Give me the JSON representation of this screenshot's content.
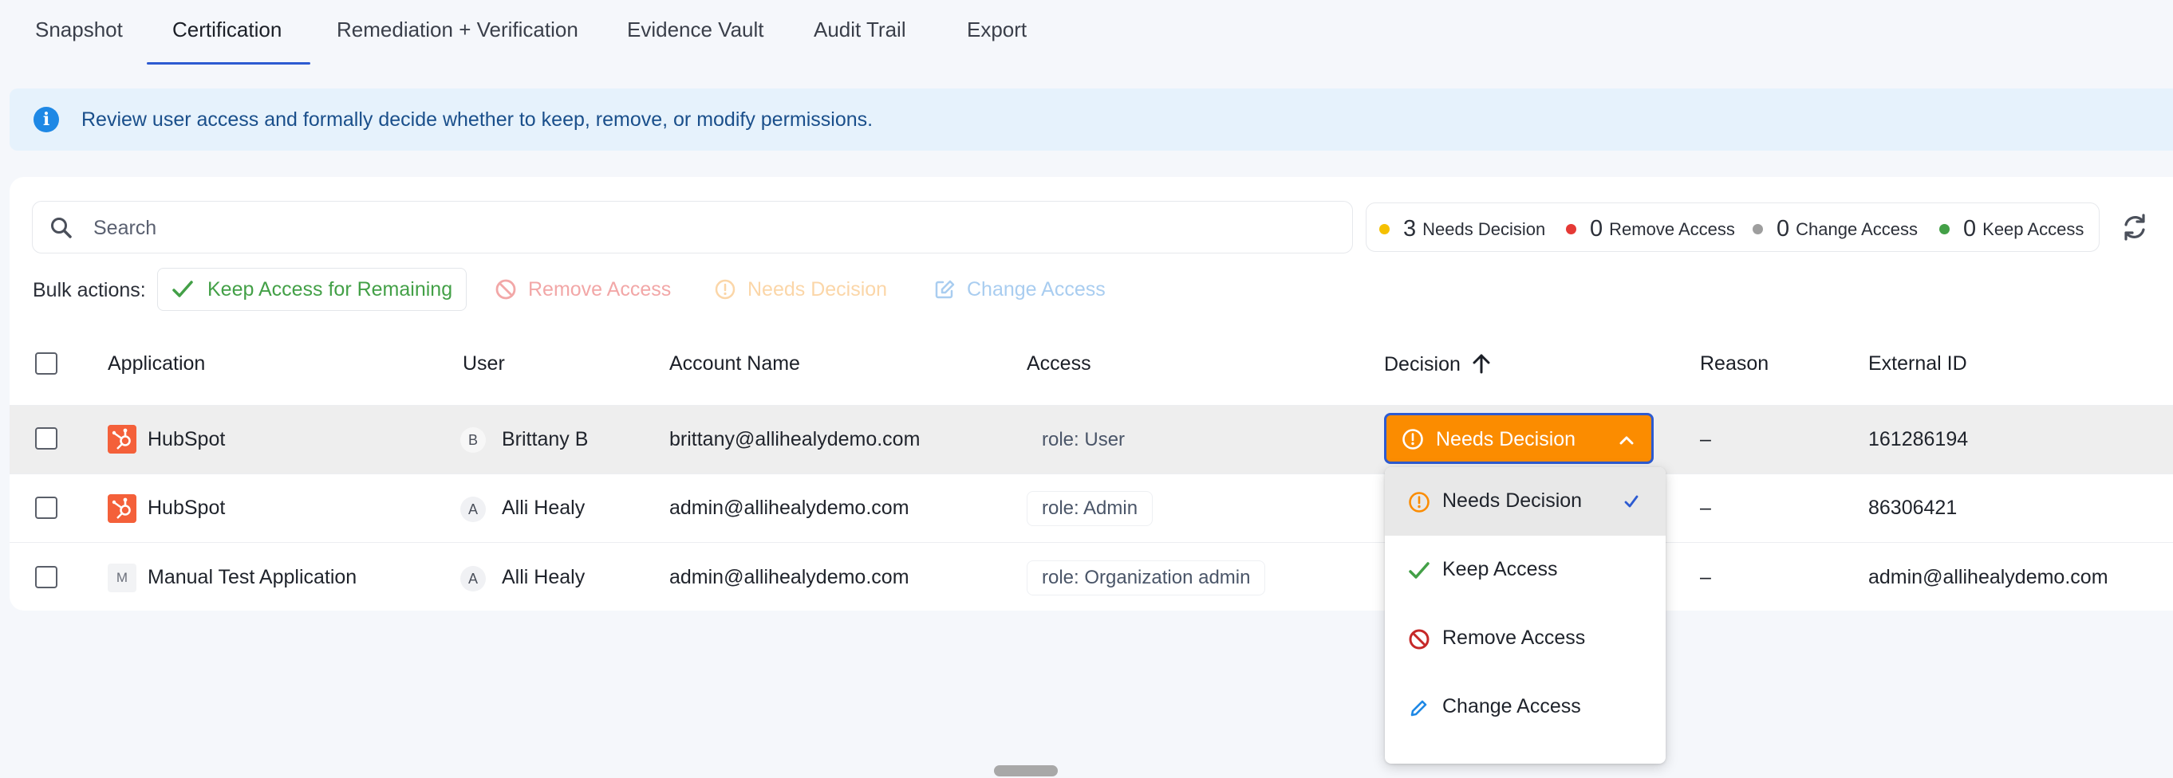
{
  "tabs": [
    {
      "label": "Snapshot"
    },
    {
      "label": "Certification"
    },
    {
      "label": "Remediation + Verification"
    },
    {
      "label": "Evidence Vault"
    },
    {
      "label": "Audit Trail"
    },
    {
      "label": "Export"
    }
  ],
  "active_tab": "Certification",
  "banner": {
    "text": "Review user access and formally decide whether to keep, remove, or modify permissions."
  },
  "search": {
    "placeholder": "Search",
    "value": ""
  },
  "counts": [
    {
      "num": "3",
      "label": "Needs Decision",
      "color": "#f5c000"
    },
    {
      "num": "0",
      "label": "Remove Access",
      "color": "#e53935"
    },
    {
      "num": "0",
      "label": "Change Access",
      "color": "#9e9e9e"
    },
    {
      "num": "0",
      "label": "Keep Access",
      "color": "#43a047"
    }
  ],
  "bulk": {
    "label": "Bulk actions:",
    "keep": "Keep Access for Remaining",
    "remove": "Remove Access",
    "needs": "Needs Decision",
    "change": "Change Access"
  },
  "table": {
    "headers": {
      "application": "Application",
      "user": "User",
      "account": "Account Name",
      "access": "Access",
      "decision": "Decision",
      "reason": "Reason",
      "external_id": "External ID"
    },
    "rows": [
      {
        "app": "HubSpot",
        "avatar": "B",
        "user": "Brittany B",
        "account": "brittany@allihealydemo.com",
        "access": "role: User",
        "reason": "–",
        "external_id": "161286194"
      },
      {
        "app": "HubSpot",
        "avatar": "A",
        "user": "Alli Healy",
        "account": "admin@allihealydemo.com",
        "access": "role: Admin",
        "reason": "–",
        "external_id": "86306421"
      },
      {
        "app": "Manual Test Application",
        "app_initial": "M",
        "avatar": "A",
        "user": "Alli Healy",
        "account": "admin@allihealydemo.com",
        "access": "role: Organization admin",
        "reason": "–",
        "external_id": "admin@allihealydemo.com"
      }
    ]
  },
  "decision_select": {
    "value": "Needs Decision"
  },
  "menu": {
    "items": [
      {
        "label": "Needs Decision"
      },
      {
        "label": "Keep Access"
      },
      {
        "label": "Remove Access"
      },
      {
        "label": "Change Access"
      }
    ]
  },
  "colors": {
    "accent": "#2d5bd1",
    "warning": "#fb8c00",
    "success": "#43a047",
    "danger": "#c62828",
    "info": "#1e88e5"
  }
}
